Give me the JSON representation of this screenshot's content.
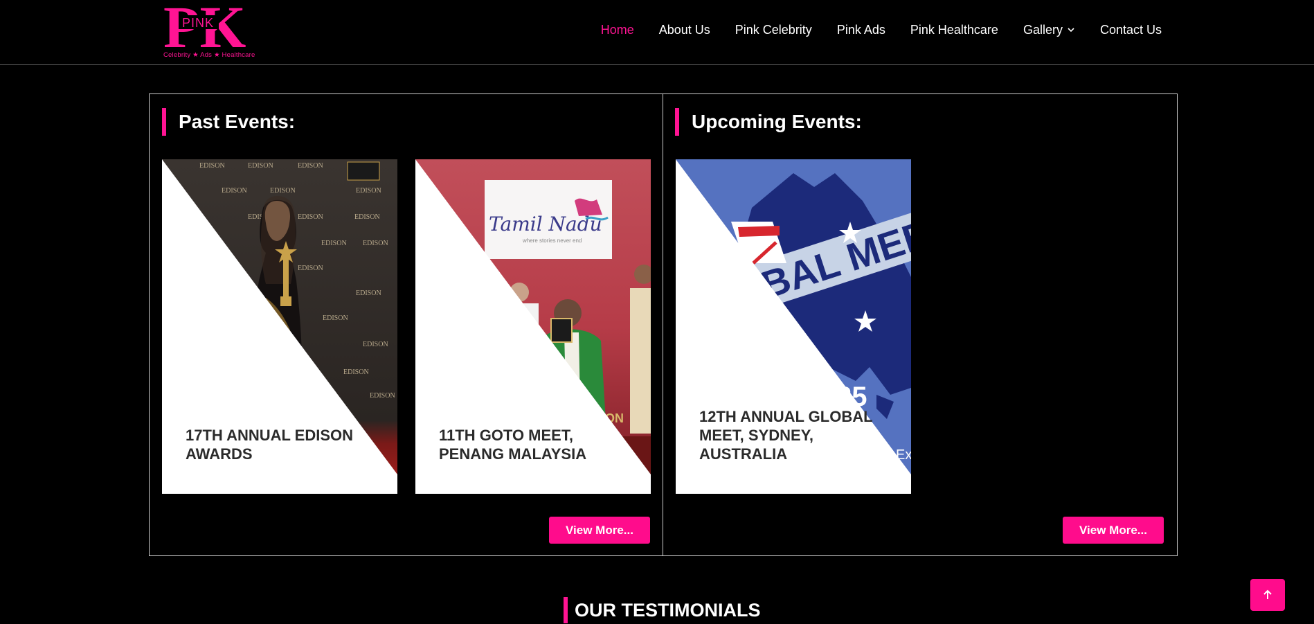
{
  "brand": {
    "logo_letters": "PK",
    "logo_word": "PINK",
    "tagline": "Celebrity ★ Ads ★ Healthcare",
    "accent_color": "#ff1493"
  },
  "nav": {
    "items": [
      {
        "label": "Home",
        "active": true
      },
      {
        "label": "About Us"
      },
      {
        "label": "Pink Celebrity"
      },
      {
        "label": "Pink Ads"
      },
      {
        "label": "Pink Healthcare"
      },
      {
        "label": "Gallery",
        "has_dropdown": true,
        "icon": "chevron-down-icon"
      },
      {
        "label": "Contact Us"
      }
    ]
  },
  "past_events": {
    "title": "Past Events:",
    "cards": [
      {
        "title": "17TH ANNUAL EDISON AWARDS",
        "image_text": "EDISON"
      },
      {
        "title": "11TH GOTO MEET, PENANG MALAYSIA",
        "image_text": "Tamil Nadu",
        "image_subtext": "where stories never end"
      }
    ],
    "view_more": "View More..."
  },
  "upcoming_events": {
    "title": "Upcoming Events:",
    "cards": [
      {
        "title": "12TH ANNUAL GLOBAL MEET, SYDNEY, AUSTRALIA",
        "image_text": "BAL MEET",
        "image_number": "25",
        "image_fragment": "Ex"
      }
    ],
    "view_more": "View More..."
  },
  "testimonials": {
    "title": "OUR TESTIMONIALS"
  },
  "scroll_top": {
    "icon": "arrow-up-icon"
  }
}
